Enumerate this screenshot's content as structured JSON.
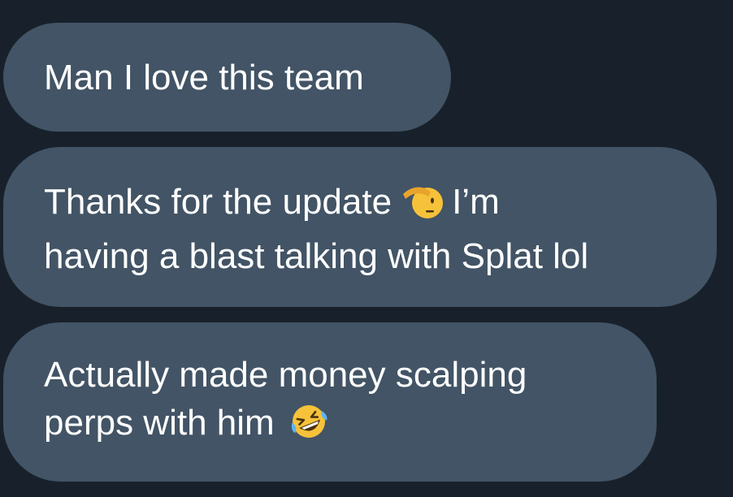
{
  "messages": [
    {
      "lines": [
        "Man I love this team"
      ]
    },
    {
      "line1_before": "Thanks for the update",
      "line1_emoji": "saluting-face-icon",
      "line1_after": "I’m",
      "line2": "having a blast talking with Splat lol"
    },
    {
      "line1": "Actually made money scalping",
      "line2_text": "perps with him",
      "line2_emoji": "rolling-on-floor-laughing-icon"
    }
  ],
  "colors": {
    "background": "#18212b",
    "bubble": "#425465",
    "text": "#ffffff",
    "emoji_yellow": "#f6c23a"
  }
}
